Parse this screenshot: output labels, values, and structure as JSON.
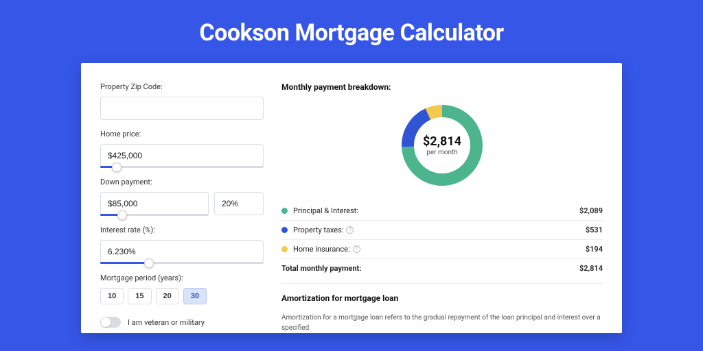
{
  "title": "Cookson Mortgage Calculator",
  "form": {
    "zip_label": "Property Zip Code:",
    "zip_value": "",
    "home_price_label": "Home price:",
    "home_price_value": "$425,000",
    "home_price_slider_pct": 10,
    "down_payment_label": "Down payment:",
    "down_payment_value": "$85,000",
    "down_payment_pct_value": "20%",
    "down_payment_slider_pct": 20,
    "interest_label": "Interest rate (%):",
    "interest_value": "6.230%",
    "interest_slider_pct": 30,
    "period_label": "Mortgage period (years):",
    "period_options": [
      "10",
      "15",
      "20",
      "30"
    ],
    "period_selected": "30",
    "veteran_label": "I am veteran or military"
  },
  "breakdown": {
    "heading": "Monthly payment breakdown:",
    "donut_amount": "$2,814",
    "donut_sub": "per month",
    "items": [
      {
        "label": "Principal & Interest:",
        "value": "$2,089",
        "color": "#4cb58e",
        "info": false
      },
      {
        "label": "Property taxes:",
        "value": "$531",
        "color": "#2f55d4",
        "info": true
      },
      {
        "label": "Home insurance:",
        "value": "$194",
        "color": "#f2c94c",
        "info": true
      }
    ],
    "total_label": "Total monthly payment:",
    "total_value": "$2,814"
  },
  "amortization": {
    "heading": "Amortization for mortgage loan",
    "text": "Amortization for a mortgage loan refers to the gradual repayment of the loan principal and interest over a specified"
  },
  "chart_data": {
    "type": "pie",
    "title": "Monthly payment breakdown",
    "categories": [
      "Principal & Interest",
      "Property taxes",
      "Home insurance"
    ],
    "values": [
      2089,
      531,
      194
    ],
    "colors": [
      "#4cb58e",
      "#2f55d4",
      "#f2c94c"
    ],
    "total": 2814
  }
}
